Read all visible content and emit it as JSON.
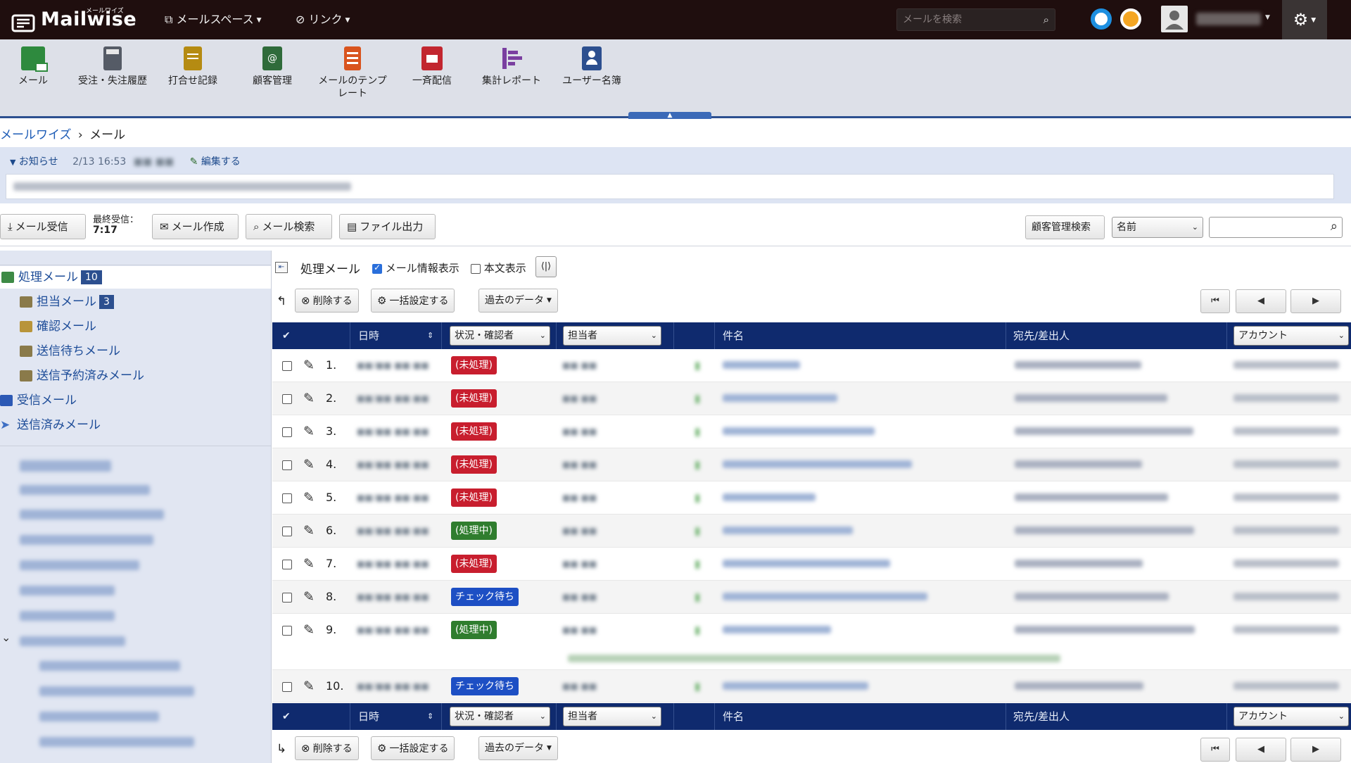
{
  "topbar": {
    "logo_ruby": "メールワイズ",
    "logo_name": "Mailwise",
    "menus": [
      "メールスペース",
      "リンク"
    ],
    "search_placeholder": "メールを検索"
  },
  "apps": [
    {
      "label": "メール",
      "icon": "mail-folder-icon",
      "color": "#2e8a3e"
    },
    {
      "label": "受注・失注履歴",
      "icon": "calculator-icon",
      "color": "#555b66"
    },
    {
      "label": "打合せ記録",
      "icon": "notebook-icon",
      "color": "#b58b12"
    },
    {
      "label": "顧客管理",
      "icon": "address-book-icon",
      "color": "#2f6b3a"
    },
    {
      "label": "メールのテンプレート",
      "icon": "template-icon",
      "color": "#d9541e"
    },
    {
      "label": "一斉配信",
      "icon": "broadcast-icon",
      "color": "#c2262f"
    },
    {
      "label": "集計レポート",
      "icon": "report-icon",
      "color": "#7a3fa0"
    },
    {
      "label": "ユーザー名簿",
      "icon": "user-directory-icon",
      "color": "#2c4f8f"
    }
  ],
  "breadcrumb": {
    "root": "メールワイズ",
    "sep": "›",
    "current": "メール"
  },
  "notice": {
    "label": "お知らせ",
    "date": "2/13 16:53",
    "edit": "編集する"
  },
  "actions": {
    "receive": "メール受信",
    "last_received_label": "最終受信：",
    "last_received_time": "7:17",
    "compose": "メール作成",
    "search": "メール検索",
    "export": "ファイル出力",
    "customer_search": "顧客管理検索",
    "customer_field": "名前"
  },
  "sidebar": {
    "items": [
      {
        "label": "処理メール",
        "count": "10"
      },
      {
        "label": "担当メール",
        "count": "3"
      },
      {
        "label": "確認メール",
        "count": ""
      },
      {
        "label": "送信待ちメール",
        "count": ""
      },
      {
        "label": "送信予約済みメール",
        "count": ""
      },
      {
        "label": "受信メール",
        "count": ""
      },
      {
        "label": "送信済みメール",
        "count": ""
      }
    ]
  },
  "main": {
    "title": "処理メール",
    "show_info": "メール情報表示",
    "show_body": "本文表示",
    "delete": "削除する",
    "bulk": "一括設定する",
    "past": "過去のデータ",
    "headers": {
      "date": "日時",
      "status": "状況・確認者",
      "assignee": "担当者",
      "subject": "件名",
      "to_from": "宛先/差出人",
      "account": "アカウント"
    },
    "rows": [
      {
        "no": "1.",
        "status": "(未処理)",
        "color": "red"
      },
      {
        "no": "2.",
        "status": "(未処理)",
        "color": "red"
      },
      {
        "no": "3.",
        "status": "(未処理)",
        "color": "red"
      },
      {
        "no": "4.",
        "status": "(未処理)",
        "color": "red"
      },
      {
        "no": "5.",
        "status": "(未処理)",
        "color": "red"
      },
      {
        "no": "6.",
        "status": "(処理中)",
        "color": "green"
      },
      {
        "no": "7.",
        "status": "(未処理)",
        "color": "red"
      },
      {
        "no": "8.",
        "status": "チェック待ち",
        "color": "blue"
      },
      {
        "no": "9.",
        "status": "(処理中)",
        "color": "green"
      },
      {
        "no": "10.",
        "status": "チェック待ち",
        "color": "blue"
      }
    ]
  },
  "colors": {
    "topbar": "#1f0e0e",
    "header": "#0f2a6e",
    "link": "#1d5cb6",
    "red": "#c81e2e",
    "green": "#2f7d2e",
    "blue": "#1d4fc4"
  }
}
